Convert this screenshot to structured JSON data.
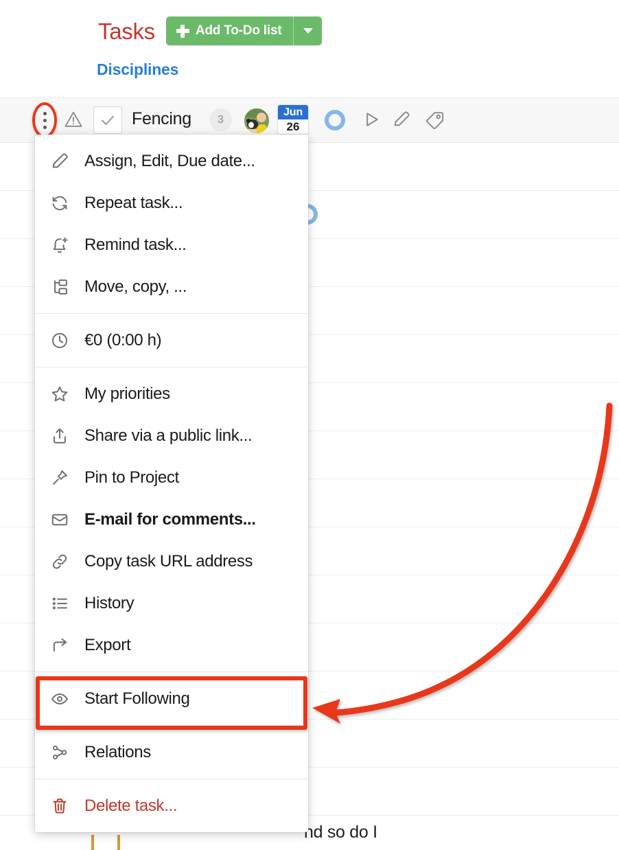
{
  "header": {
    "page_title": "Tasks",
    "add_button_label": "Add To-Do list",
    "add_button_icon": "plus-icon",
    "add_button_caret_icon": "chevron-down-icon",
    "add_button_color": "#6aba6a",
    "title_color": "#c0392b"
  },
  "breadcrumb": {
    "label": "Disciplines",
    "color": "#2a7fd4"
  },
  "task_row": {
    "menu_icon": "three-dots-vertical-icon",
    "warning_icon": "warning-triangle-icon",
    "checkbox_icon": "check-icon",
    "name": "Fencing",
    "comment_count": "3",
    "assignee_avatar": "user-avatar",
    "due_date_month": "Jun",
    "due_date_day": "26",
    "status_icon": "circle-ring-icon",
    "timer_icon": "play-icon",
    "edit_icon": "pencil-icon",
    "tag_icon": "tag-icon",
    "highlight_color": "#e8381a"
  },
  "background": {
    "partial_text": "nd so do I"
  },
  "menu": {
    "groups": [
      {
        "items": [
          {
            "label": "Assign, Edit, Due date...",
            "icon": "pencil-icon",
            "bold": false,
            "danger": false
          },
          {
            "label": "Repeat task...",
            "icon": "repeat-icon",
            "bold": false,
            "danger": false
          },
          {
            "label": "Remind task...",
            "icon": "bell-plus-icon",
            "bold": false,
            "danger": false
          },
          {
            "label": "Move, copy, ...",
            "icon": "move-copy-icon",
            "bold": false,
            "danger": false
          }
        ]
      },
      {
        "items": [
          {
            "label": "€0 (0:00 h)",
            "icon": "clock-icon",
            "bold": false,
            "danger": false
          }
        ]
      },
      {
        "items": [
          {
            "label": "My priorities",
            "icon": "star-icon",
            "bold": false,
            "danger": false
          },
          {
            "label": "Share via a public link...",
            "icon": "share-upload-icon",
            "bold": false,
            "danger": false
          },
          {
            "label": "Pin to Project",
            "icon": "pin-icon",
            "bold": false,
            "danger": false
          },
          {
            "label": "E-mail for comments...",
            "icon": "envelope-icon",
            "bold": true,
            "danger": false
          },
          {
            "label": "Copy task URL address",
            "icon": "link-icon",
            "bold": false,
            "danger": false
          },
          {
            "label": "History",
            "icon": "list-icon",
            "bold": false,
            "danger": false
          },
          {
            "label": "Export",
            "icon": "arrow-export-icon",
            "bold": false,
            "danger": false
          }
        ]
      },
      {
        "items": [
          {
            "label": "Start Following",
            "icon": "eye-icon",
            "bold": false,
            "danger": false,
            "highlighted": true
          }
        ]
      },
      {
        "items": [
          {
            "label": "Relations",
            "icon": "relations-icon",
            "bold": false,
            "danger": false
          }
        ]
      },
      {
        "items": [
          {
            "label": "Delete task...",
            "icon": "trash-icon",
            "bold": false,
            "danger": true
          }
        ]
      }
    ]
  },
  "annotation": {
    "arrow_color": "#e8381a",
    "points_to": "Start Following",
    "highlight_box_color": "#e8381a"
  }
}
